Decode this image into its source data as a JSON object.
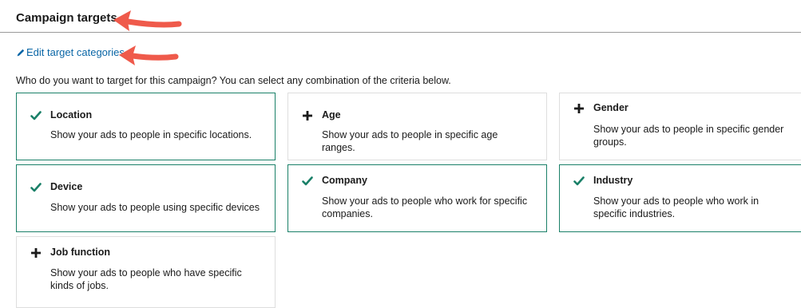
{
  "header": {
    "title": "Campaign targets",
    "edit_link": "Edit target categories"
  },
  "prompt": "Who do you want to target for this campaign? You can select any combination of the criteria below.",
  "colors": {
    "accent": "#1a8068",
    "link": "#0a66a6",
    "annotation_arrow": "#ef5a4b"
  },
  "cards": [
    {
      "title": "Location",
      "desc": "Show your ads to people in specific locations.",
      "selected": true,
      "icon": "checkmark-icon"
    },
    {
      "title": "Age",
      "desc": "Show your ads to people in specific age ranges.",
      "selected": false,
      "icon": "plus-icon"
    },
    {
      "title": "Gender",
      "desc": "Show your ads to people in specific gender groups.",
      "selected": false,
      "icon": "plus-icon"
    },
    {
      "title": "Device",
      "desc": "Show your ads to people using specific devices",
      "selected": true,
      "icon": "checkmark-icon"
    },
    {
      "title": "Company",
      "desc": "Show your ads to people who work for specific companies.",
      "selected": true,
      "icon": "checkmark-icon"
    },
    {
      "title": "Industry",
      "desc": "Show your ads to people who work in specific industries.",
      "selected": true,
      "icon": "checkmark-icon"
    },
    {
      "title": "Job function",
      "desc": "Show your ads to people who have specific kinds of jobs.",
      "selected": false,
      "icon": "plus-icon"
    }
  ]
}
